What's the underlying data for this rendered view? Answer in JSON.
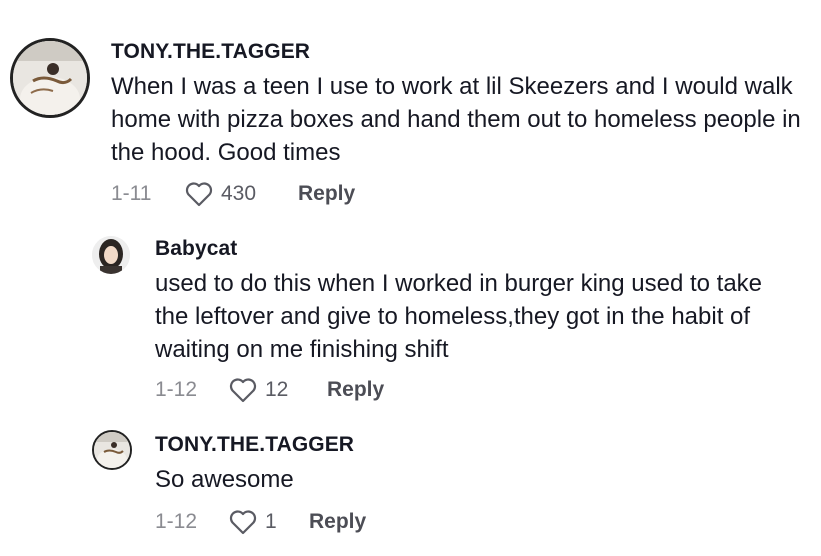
{
  "comments": [
    {
      "username": "TONY.THE.TAGGER",
      "text": "When I was a teen I use to work at lil Skeezers and I would walk home with pizza boxes and hand them out to homeless people in the hood. Good times",
      "date": "1-11",
      "likes": "430",
      "reply_label": "Reply",
      "avatar_icon": "avatar-tony"
    },
    {
      "username": "Babycat",
      "text": "used to do this when I worked in burger king used to take the leftover and give to homeless,they got in the habit of waiting on me finishing shift",
      "date": "1-12",
      "likes": "12",
      "reply_label": "Reply",
      "avatar_icon": "avatar-babycat"
    },
    {
      "username": "TONY.THE.TAGGER",
      "text": "So awesome",
      "date": "1-12",
      "likes": "1",
      "reply_label": "Reply",
      "avatar_icon": "avatar-tony"
    }
  ],
  "colors": {
    "text": "#161823",
    "muted": "#8a8b91",
    "icon": "#5a5b63"
  }
}
